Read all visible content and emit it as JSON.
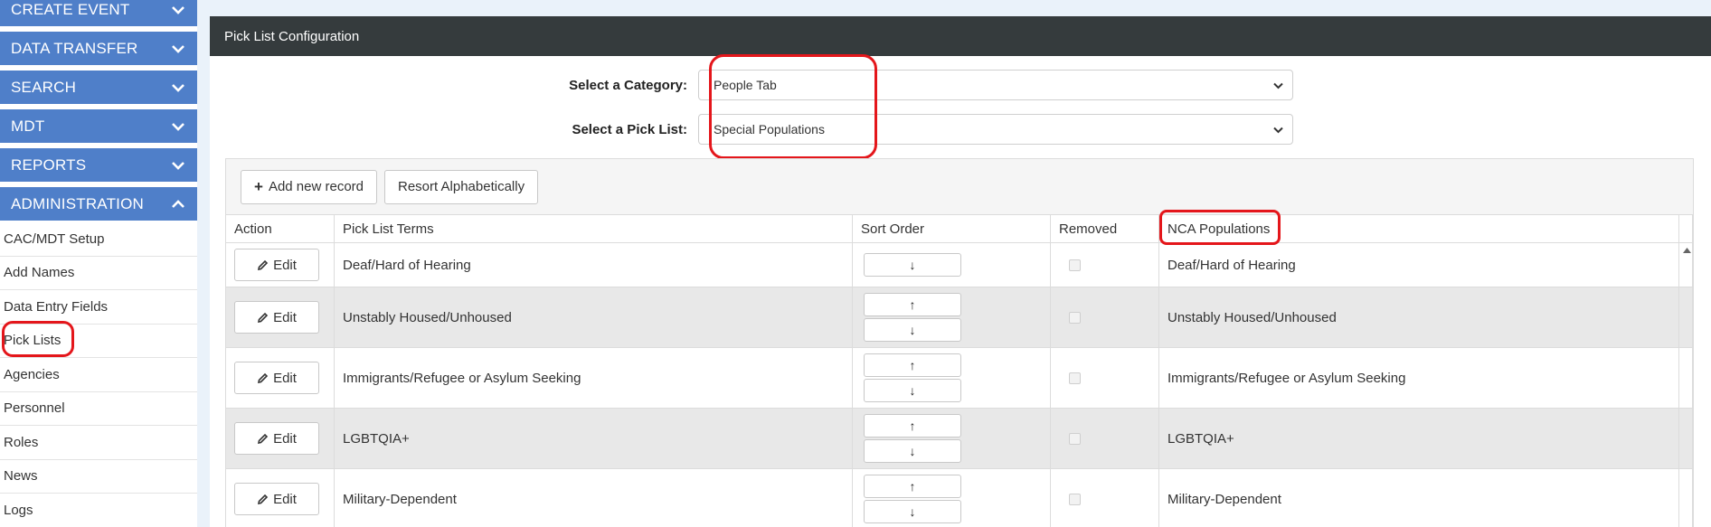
{
  "sidebar": {
    "sections": [
      {
        "label": "CREATE EVENT",
        "expanded": false
      },
      {
        "label": "DATA TRANSFER",
        "expanded": false
      },
      {
        "label": "SEARCH",
        "expanded": false
      },
      {
        "label": "MDT",
        "expanded": false
      },
      {
        "label": "REPORTS",
        "expanded": false
      },
      {
        "label": "ADMINISTRATION",
        "expanded": true
      }
    ],
    "items": [
      {
        "label": "CAC/MDT Setup"
      },
      {
        "label": "Add Names"
      },
      {
        "label": "Data Entry Fields"
      },
      {
        "label": "Pick Lists"
      },
      {
        "label": "Agencies"
      },
      {
        "label": "Personnel"
      },
      {
        "label": "Roles"
      },
      {
        "label": "News"
      },
      {
        "label": "Logs"
      }
    ]
  },
  "panel": {
    "title": "Pick List Configuration",
    "category": {
      "label": "Select a Category:",
      "value": "People Tab"
    },
    "picklist": {
      "label": "Select a Pick List:",
      "value": "Special Populations"
    }
  },
  "toolbar": {
    "add_label": "Add new record",
    "add_icon": "+",
    "resort_label": "Resort Alphabetically"
  },
  "table": {
    "headers": {
      "action": "Action",
      "terms": "Pick List Terms",
      "sort": "Sort Order",
      "removed": "Removed",
      "nca": "NCA Populations"
    },
    "edit_label": "Edit",
    "up_arrow": "↑",
    "down_arrow": "↓",
    "rows": [
      {
        "term": "Deaf/Hard of Hearing",
        "nca": "Deaf/Hard of Hearing",
        "removed": false
      },
      {
        "term": "Unstably Housed/Unhoused",
        "nca": "Unstably Housed/Unhoused",
        "removed": false
      },
      {
        "term": "Immigrants/Refugee or Asylum Seeking",
        "nca": "Immigrants/Refugee or Asylum Seeking",
        "removed": false
      },
      {
        "term": "LGBTQIA+",
        "nca": "LGBTQIA+",
        "removed": false
      },
      {
        "term": "Military-Dependent",
        "nca": "Military-Dependent",
        "removed": false
      }
    ]
  },
  "colors": {
    "nav_blue": "#4f7fc9",
    "panel_header": "#353b3d",
    "highlight_red": "#e4161b",
    "page_bg": "#eaf2fa"
  }
}
